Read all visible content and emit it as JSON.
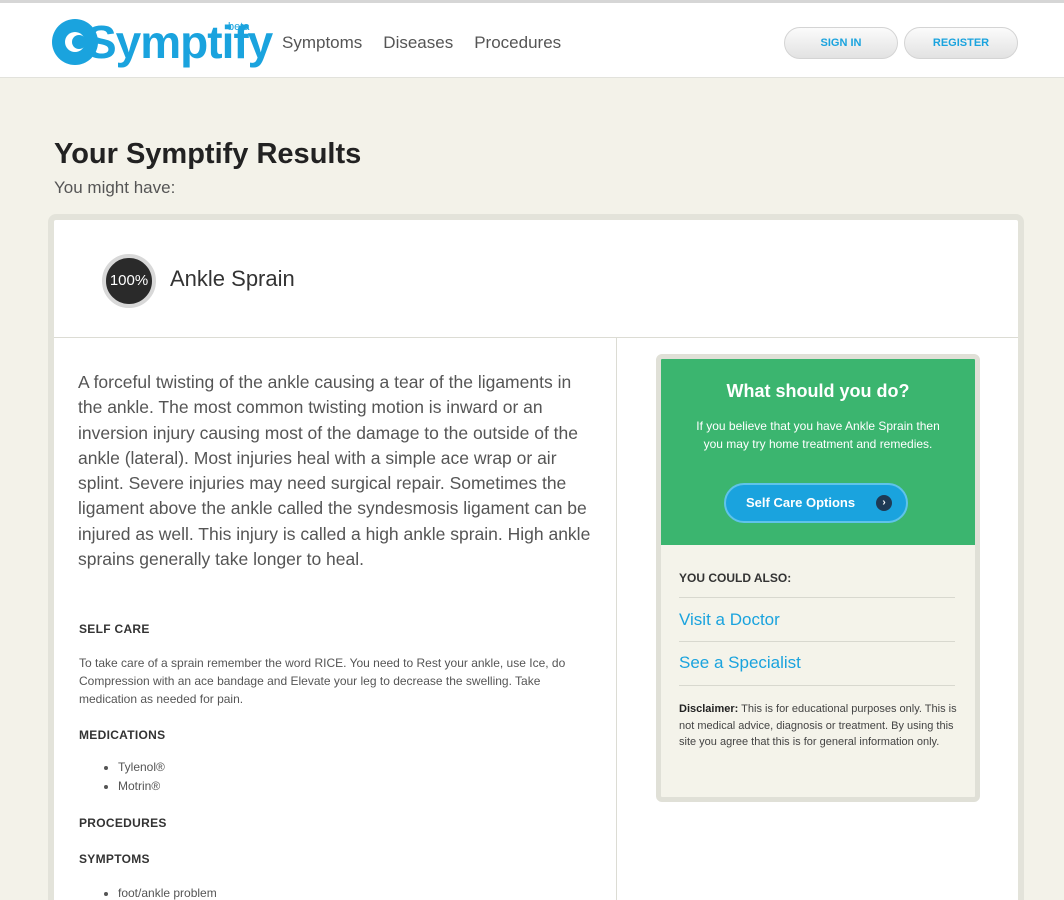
{
  "header": {
    "logo_text": "Symptify",
    "logo_badge": "beta",
    "nav": [
      "Symptoms",
      "Diseases",
      "Procedures"
    ],
    "sign_in": "SIGN IN",
    "register": "REGISTER"
  },
  "page": {
    "title": "Your Symptify Results",
    "subtitle": "You might have:"
  },
  "result": {
    "percent": "100%",
    "name": "Ankle Sprain",
    "description": "A forceful twisting of the ankle causing a tear of the ligaments in the ankle. The most common twisting motion is inward or an inversion injury causing most of the damage to the outside of the ankle (lateral). Most injuries heal with a simple ace wrap or air splint. Severe injuries may need surgical repair. Sometimes the ligament above the ankle called the syndesmosis ligament can be injured as well. This injury is called a high ankle sprain. High ankle sprains generally take longer to heal.",
    "self_care_heading": "SELF CARE",
    "self_care_text": "To take care of a sprain remember the word RICE. You need to Rest your ankle, use Ice, do Compression with an ace bandage and Elevate your leg to decrease the swelling. Take medication as needed for pain.",
    "medications_heading": "MEDICATIONS",
    "medications": [
      "Tylenol®",
      "Motrin®"
    ],
    "procedures_heading": "PROCEDURES",
    "symptoms_heading": "SYMPTOMS",
    "symptoms": [
      "foot/ankle problem"
    ]
  },
  "panel": {
    "title": "What should you do?",
    "text": "If you believe that you have Ankle Sprain then you may try home treatment and remedies.",
    "button": "Self Care Options",
    "button_arrow": "›",
    "also_heading": "YOU COULD ALSO:",
    "links": [
      "Visit a Doctor",
      "See a Specialist"
    ],
    "disclaimer_label": "Disclaimer:",
    "disclaimer_text": " This is for educational purposes only. This is not medical advice, diagnosis or treatment. By using this site you agree that this is for general information only."
  },
  "colors": {
    "brand_blue": "#1aa3de",
    "green": "#3bb56f",
    "page_bg": "#f3f2e9"
  }
}
